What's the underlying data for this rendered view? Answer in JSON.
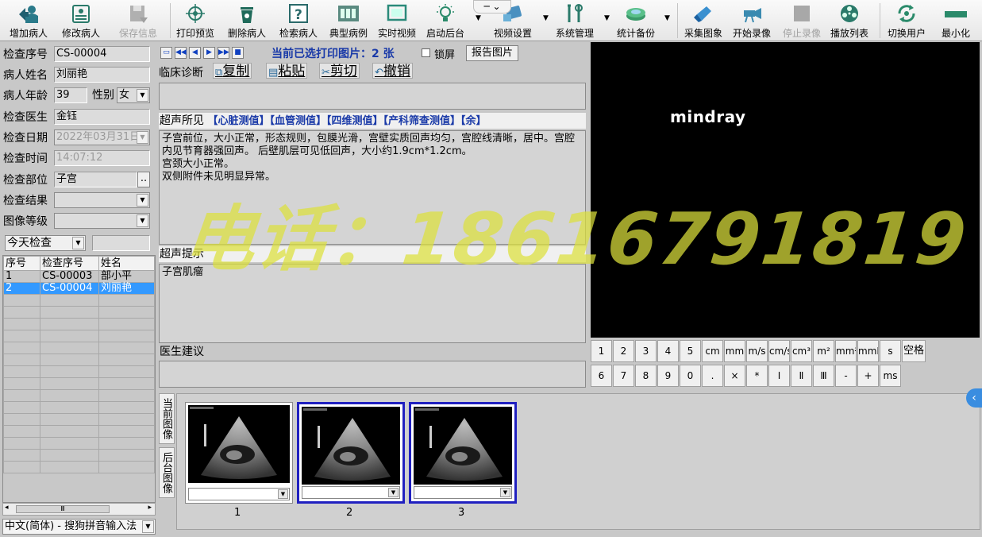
{
  "toolbar": {
    "buttons": [
      {
        "label": "增加病人",
        "icon": "add-patient-icon"
      },
      {
        "label": "修改病人",
        "icon": "edit-patient-icon"
      },
      {
        "label": "保存信息",
        "icon": "save-icon",
        "disabled": true
      },
      {
        "label": "打印预览",
        "icon": "crosshair-icon"
      },
      {
        "label": "删除病人",
        "icon": "trash-icon"
      },
      {
        "label": "检索病人",
        "icon": "question-icon"
      },
      {
        "label": "典型病例",
        "icon": "film-strip-icon"
      },
      {
        "label": "实时视频",
        "icon": "screen-icon"
      },
      {
        "label": "启动后台",
        "icon": "bulb-icon"
      },
      {
        "label": "视频设置",
        "icon": "video-settings-icon"
      },
      {
        "label": "系统管理",
        "icon": "tools-icon"
      },
      {
        "label": "统计备份",
        "icon": "database-icon"
      },
      {
        "label": "采集图象",
        "icon": "capture-icon"
      },
      {
        "label": "开始录像",
        "icon": "record-icon"
      },
      {
        "label": "停止录像",
        "icon": "stop-icon",
        "disabled": true
      },
      {
        "label": "播放列表",
        "icon": "film-reel-icon"
      },
      {
        "label": "切换用户",
        "icon": "switch-user-icon"
      },
      {
        "label": "最小化",
        "icon": "minimize-icon"
      }
    ],
    "window_controls": "─ ⌄"
  },
  "patient": {
    "exam_no_label": "检查序号",
    "exam_no": "CS-00004",
    "name_label": "病人姓名",
    "name": "刘丽艳",
    "age_label": "病人年龄",
    "age": "39",
    "sex_label": "性别",
    "sex": "女",
    "doctor_label": "检查医生",
    "doctor": "金钰",
    "date_label": "检查日期",
    "date": "2022年03月31日",
    "time_label": "检查时间",
    "time": "14:07:12",
    "part_label": "检查部位",
    "part": "子宫",
    "result_label": "检查结果",
    "result": "",
    "grade_label": "图像等级",
    "grade": "",
    "filter": "今天检查",
    "filter_text": ""
  },
  "list": {
    "headers": [
      "序号",
      "检查序号",
      "姓名"
    ],
    "rows": [
      {
        "no": "1",
        "exam": "CS-00003",
        "name": "部小平"
      },
      {
        "no": "2",
        "exam": "CS-00004",
        "name": "刘丽艳"
      }
    ],
    "scroll_label": "Ⅲ",
    "ime": "中文(简体) - 搜狗拼音输入法"
  },
  "report": {
    "print_status": "当前已选打印图片：2 张",
    "lock_label": "锁屏",
    "report_image_btn": "报告图片",
    "clinical_label": "临床诊断",
    "copy": "复制",
    "paste": "粘贴",
    "cut": "剪切",
    "undo": "撤销",
    "clinical_text": "",
    "findings_label": "超声所见",
    "findings_links": "【心脏测值】【血管测值】【四维测值】【产科筛查测值】【余】",
    "findings_text": "子宫前位，大小正常，形态规则，包膜光滑，宫壁实质回声均匀，宫腔线清晰，居中。宫腔内见节育器强回声。 后壁肌层可见低回声，大小约1.9cm*1.2cm。\n宫颈大小正常。\n双侧附件未见明显异常。",
    "hint_label": "超声提示",
    "hint_text": "子宫肌瘤",
    "advice_label": "医生建议",
    "advice_text": ""
  },
  "video": {
    "brand": "mindray"
  },
  "keypad": {
    "row1": [
      "1",
      "2",
      "3",
      "4",
      "5",
      "cm",
      "mm",
      "m/s",
      "cm/s",
      "cm³",
      "m²",
      "mm²",
      "mmHg",
      "s",
      "空格"
    ],
    "row2": [
      "6",
      "7",
      "8",
      "9",
      "0",
      ".",
      "×",
      "*",
      "Ⅰ",
      "Ⅱ",
      "Ⅲ",
      "-",
      "+",
      "ms"
    ]
  },
  "thumbs": {
    "tab_current": "当前图像",
    "tab_back": "后台图像",
    "items": [
      {
        "num": "1",
        "selected": false
      },
      {
        "num": "2",
        "selected": true
      },
      {
        "num": "3",
        "selected": true
      }
    ]
  },
  "watermark": "电话：18616791819",
  "colors": {
    "accent": "#3399ff",
    "link": "#1a3aa8",
    "watermark": "#dce13c"
  }
}
